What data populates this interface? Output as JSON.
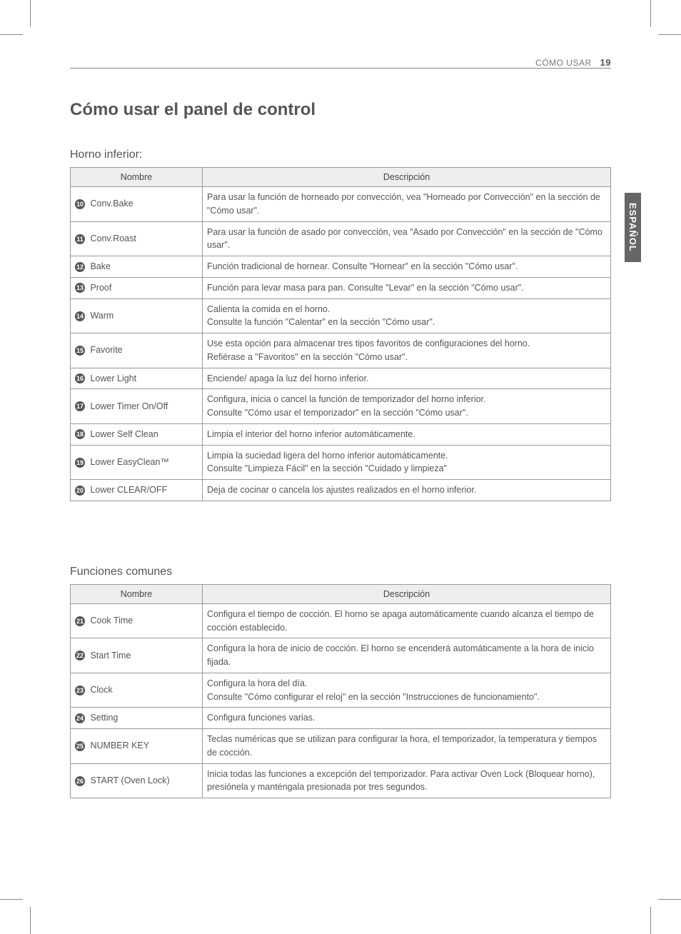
{
  "header": {
    "section": "CÓMO USAR",
    "page_number": "19"
  },
  "title": "Cómo usar el panel de control",
  "lang_tab": "ESPAÑOL",
  "table1": {
    "heading": "Horno inferior:",
    "col_name": "Nombre",
    "col_desc": "Descripción",
    "rows": [
      {
        "num": "10",
        "name": "Conv.Bake",
        "desc": "Para usar la función de horneado por convección, vea \"Horneado por Convección\" en la sección de \"Cómo usar\"."
      },
      {
        "num": "11",
        "name": "Conv.Roast",
        "desc": "Para usar la función de asado por convección, vea \"Asado por Convección\" en la sección de \"Cómo usar\"."
      },
      {
        "num": "12",
        "name": "Bake",
        "desc": "Función tradicional de hornear. Consulte \"Hornear\" en la sección \"Cómo usar\"."
      },
      {
        "num": "13",
        "name": "Proof",
        "desc": "Función para levar masa para pan. Consulte \"Levar\" en la sección \"Cómo usar\"."
      },
      {
        "num": "14",
        "name": "Warm",
        "desc": "Calienta la comida en el horno.\nConsulte la función \"Calentar\" en la sección \"Cómo usar\"."
      },
      {
        "num": "15",
        "name": "Favorite",
        "desc": "Use esta opción para almacenar tres tipos favoritos de configuraciones del horno.\nRefiérase a \"Favoritos\" en la sección \"Cómo usar\"."
      },
      {
        "num": "16",
        "name": "Lower Light",
        "desc": "Enciende/ apaga la luz del horno inferior."
      },
      {
        "num": "17",
        "name": "Lower Timer On/Off",
        "desc": "Configura, inicia o cancel la función de temporizador del horno inferior.\nConsulte \"Cómo usar el temporizador\" en la sección \"Cómo usar\"."
      },
      {
        "num": "18",
        "name": "Lower Self Clean",
        "desc": "Limpia el interior del horno inferior automáticamente."
      },
      {
        "num": "19",
        "name": "Lower EasyClean™",
        "desc": "Limpia la suciedad ligera del horno inferior automáticamente.\nConsulte \"Limpieza Fácil\" en la sección \"Cuidado y limpieza\""
      },
      {
        "num": "20",
        "name": "Lower CLEAR/OFF",
        "desc": "Deja de cocinar o cancela los ajustes realizados en el horno inferior."
      }
    ]
  },
  "table2": {
    "heading": "Funciones comunes",
    "col_name": "Nombre",
    "col_desc": "Descripción",
    "rows": [
      {
        "num": "21",
        "name": "Cook Time",
        "desc": "Configura el tiempo de cocción. El horno se apaga automáticamente cuando alcanza el tiempo de cocción establecido."
      },
      {
        "num": "22",
        "name": "Start Time",
        "desc": "Configura la hora de inicio de cocción. El horno se encenderá automáticamente a la hora de inicio fijada."
      },
      {
        "num": "23",
        "name": "Clock",
        "desc": "Configura la hora del día.\nConsulte \"Cómo configurar el reloj\" en la sección \"Instrucciones de funcionamiento\"."
      },
      {
        "num": "24",
        "name": "Setting",
        "desc": "Configura funciones varias."
      },
      {
        "num": "25",
        "name": "NUMBER KEY",
        "desc": "Teclas numéricas que se utilizan para configurar la hora, el temporizador, la temperatura y tiempos de cocción."
      },
      {
        "num": "26",
        "name": "START (Oven Lock)",
        "desc": "Inicia todas las funciones a excepción del temporizador. Para activar Oven Lock (Bloquear horno), presiónela y manténgala presionada por tres segundos."
      }
    ]
  }
}
